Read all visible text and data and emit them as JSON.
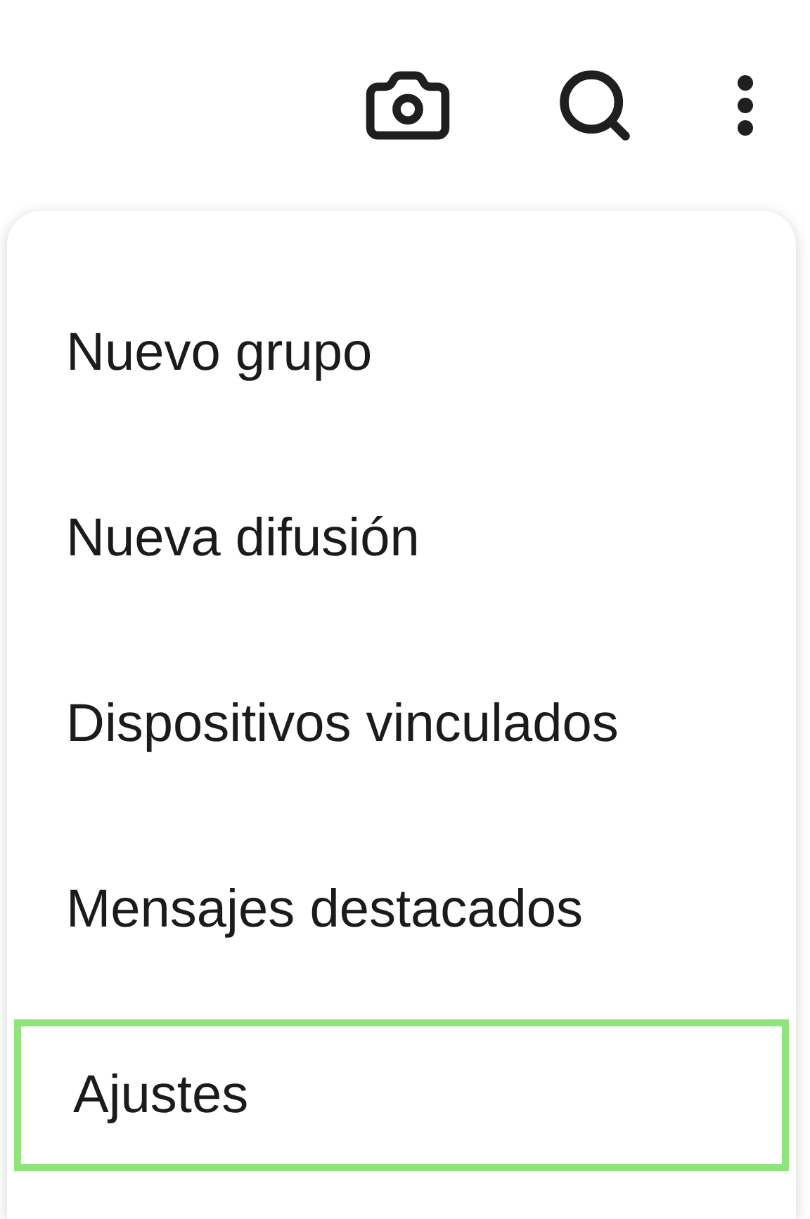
{
  "menu": {
    "items": [
      {
        "label": "Nuevo grupo",
        "highlighted": false
      },
      {
        "label": "Nueva difusión",
        "highlighted": false
      },
      {
        "label": "Dispositivos vinculados",
        "highlighted": false
      },
      {
        "label": "Mensajes destacados",
        "highlighted": false
      },
      {
        "label": "Ajustes",
        "highlighted": true
      }
    ]
  }
}
